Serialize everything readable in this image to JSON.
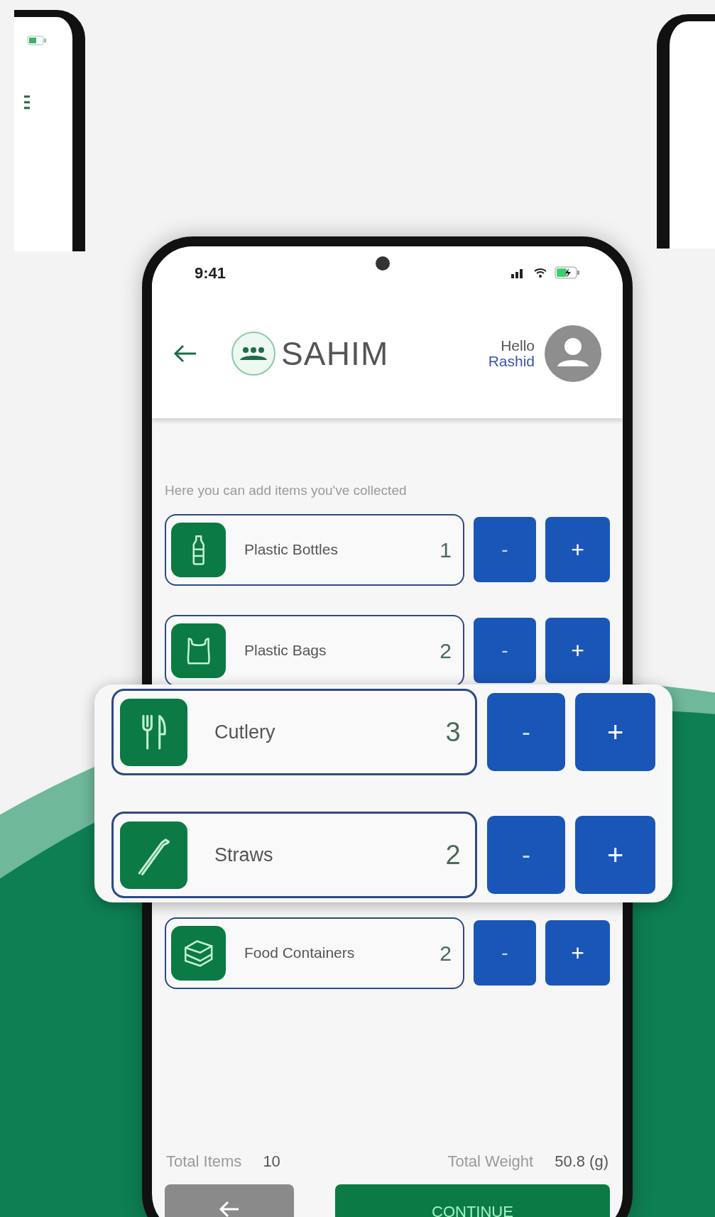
{
  "status_bar": {
    "time": "9:41"
  },
  "header": {
    "logo_text": "SAHIM",
    "greeting": "Hello",
    "user_name": "Rashid"
  },
  "intro": "Here you can add items you've collected",
  "items": [
    {
      "name": "Plastic Bottles",
      "count": "1",
      "kind": "bottle",
      "magnified": false,
      "decrement": "-",
      "increment": "+"
    },
    {
      "name": "Plastic Bags",
      "count": "2",
      "kind": "bag",
      "magnified": false,
      "decrement": "-",
      "increment": "+"
    },
    {
      "name": "Cutlery",
      "count": "3",
      "kind": "cutlery",
      "magnified": true,
      "decrement": "-",
      "increment": "+"
    },
    {
      "name": "Straws",
      "count": "2",
      "kind": "straw",
      "magnified": true,
      "decrement": "-",
      "increment": "+"
    },
    {
      "name": "Food Containers",
      "count": "2",
      "kind": "container",
      "magnified": false,
      "decrement": "-",
      "increment": "+"
    }
  ],
  "totals": {
    "items_label": "Total Items",
    "items_value": "10",
    "weight_label": "Total Weight",
    "weight_value": "50.8 (g)"
  },
  "continue_button": "CONTINUE"
}
